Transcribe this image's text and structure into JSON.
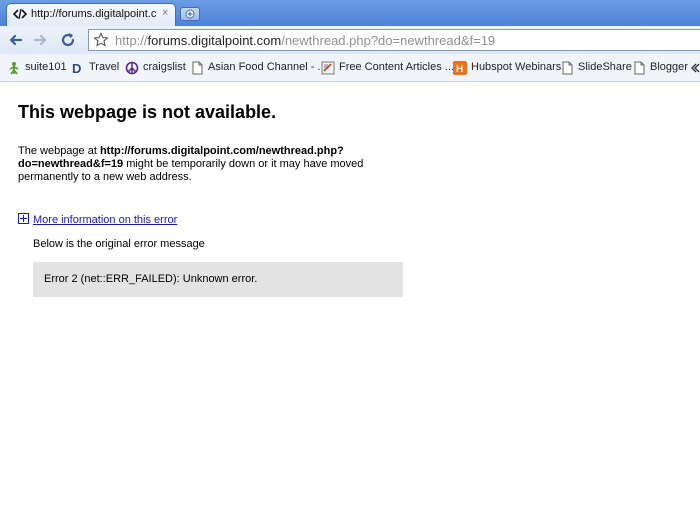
{
  "tab": {
    "title": "http://forums.digitalpoint.c...",
    "close_glyph": "×"
  },
  "omnibox": {
    "url_scheme": "http://",
    "url_host": "forums.digitalpoint.com",
    "url_path": "/newthread.php?do=newthread&f=19"
  },
  "bookmarks": [
    {
      "label": "suite101",
      "icon": "suite101-icon"
    },
    {
      "label": "Travel",
      "icon": "travel-d-icon"
    },
    {
      "label": "craigslist",
      "icon": "peace-icon"
    },
    {
      "label": "Asian Food Channel - ...",
      "icon": "page-icon"
    },
    {
      "label": "Free Content Articles ...",
      "icon": "article-icon"
    },
    {
      "label": "Hubspot Webinars",
      "icon": "hubspot-icon"
    },
    {
      "label": "SlideShare",
      "icon": "page-icon"
    },
    {
      "label": "Blogger",
      "icon": "page-icon"
    }
  ],
  "error_page": {
    "title": "This webpage is not available.",
    "desc_prefix": "The webpage at ",
    "desc_url": "http://forums.digitalpoint.com/newthread.php?do=newthread&f=19",
    "desc_suffix": " might be temporarily down or it may have moved permanently to a new web address.",
    "more_info_label": "More information on this error",
    "below_label": "Below is the original error message",
    "error_message": "Error 2 (net::ERR_FAILED): Unknown error."
  },
  "colors": {
    "link": "#1a1aa6",
    "error_box_bg": "#e3e3e3",
    "tabstrip": "#5b8fdd"
  }
}
